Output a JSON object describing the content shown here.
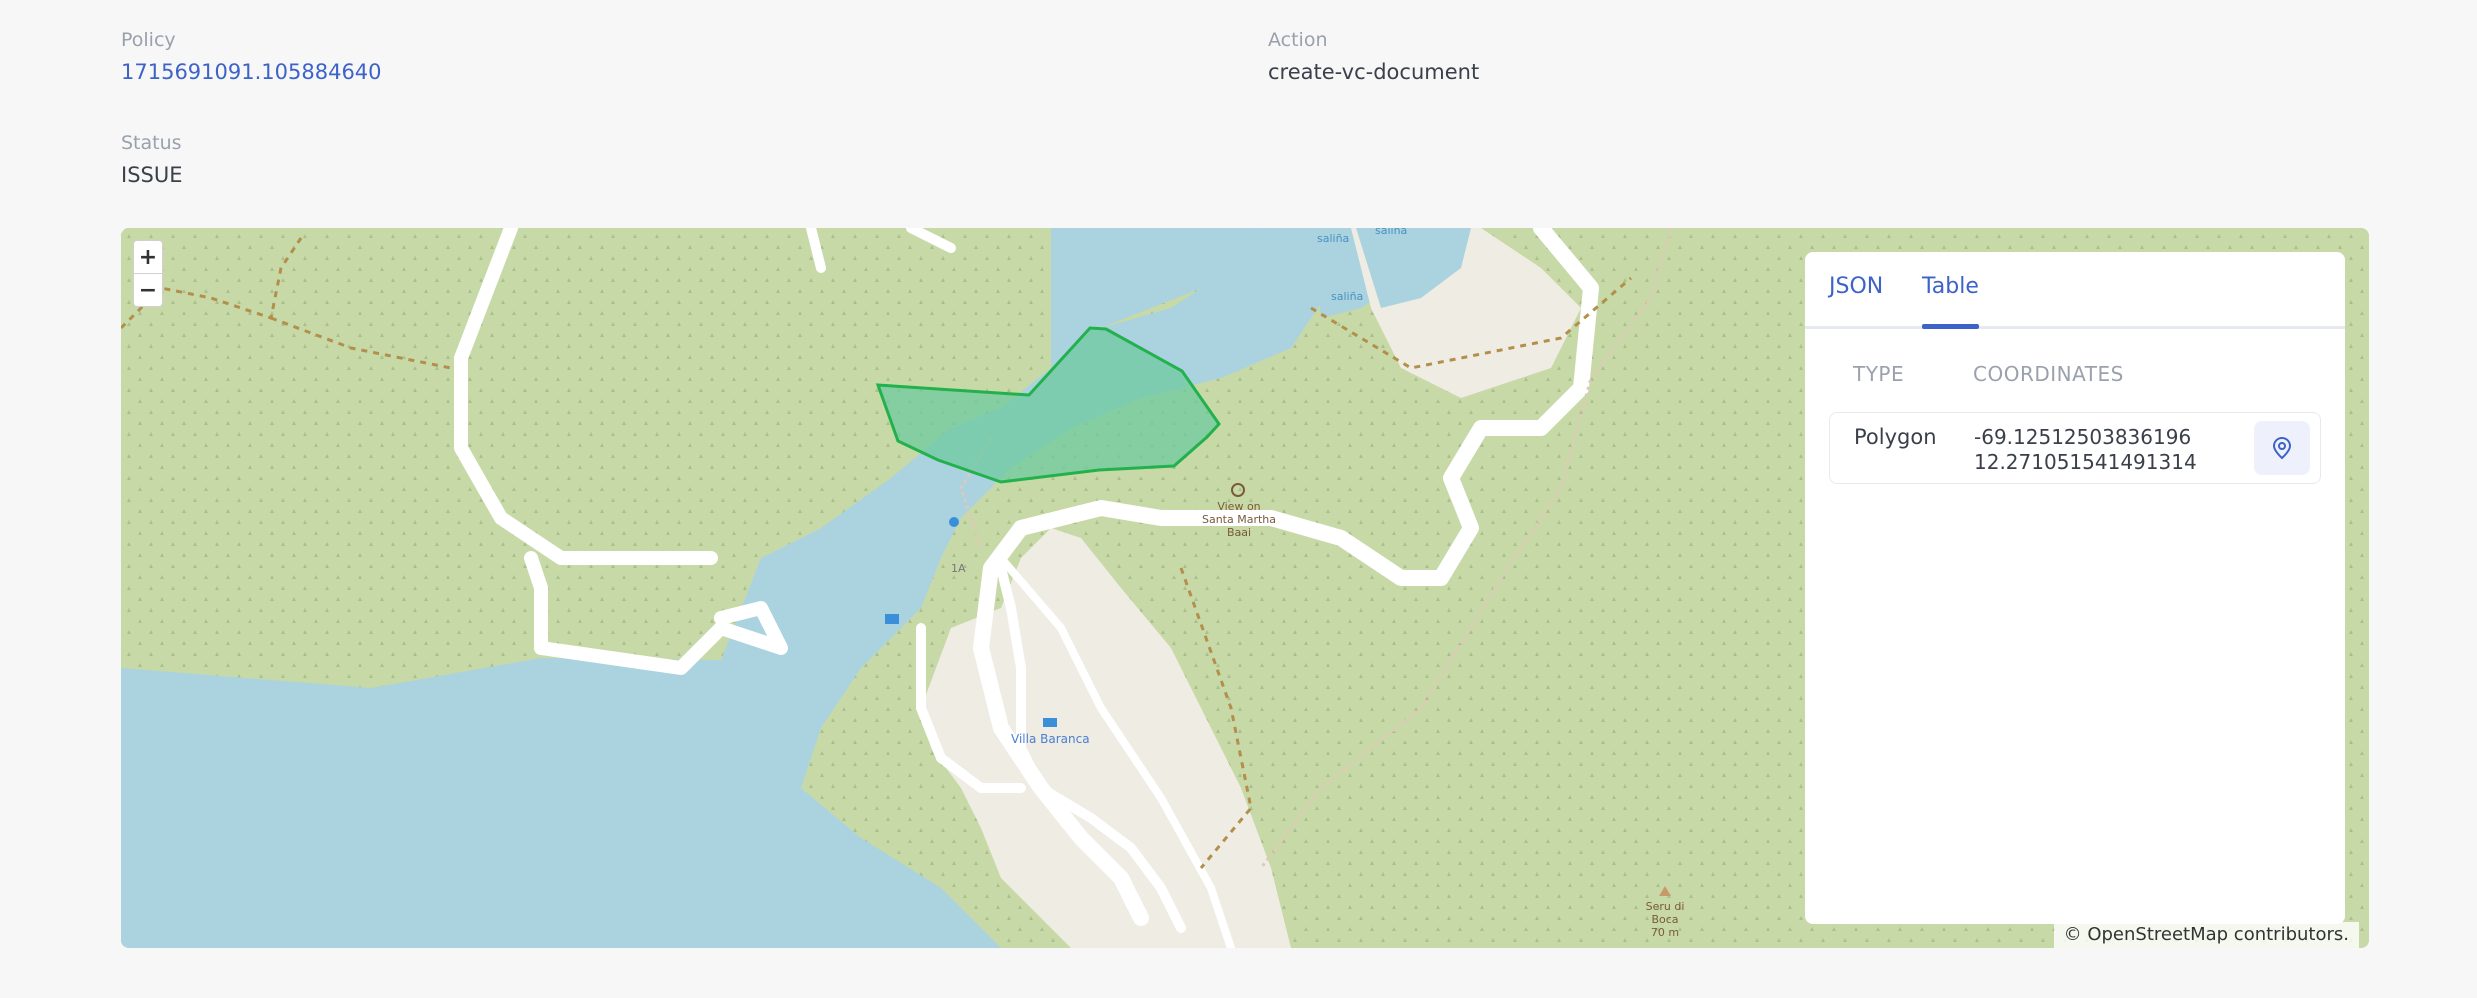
{
  "fields": {
    "policy": {
      "label": "Policy",
      "value": "1715691091.105884640"
    },
    "action": {
      "label": "Action",
      "value": "create-vc-document"
    },
    "status": {
      "label": "Status",
      "value": "ISSUE"
    }
  },
  "map": {
    "zoom_in": "+",
    "zoom_out": "−",
    "attribution": "© OpenStreetMap contributors.",
    "labels": {
      "salina1": "saliña",
      "salina2": "saliña",
      "salina3": "saliña",
      "viewpoint_1": "View on",
      "viewpoint_2": "Santa Martha",
      "viewpoint_3": "Baai",
      "road": "1A",
      "villa": "Villa Baranca",
      "peak_1": "Seru di",
      "peak_2": "Boca",
      "peak_3": "70 m"
    },
    "colors": {
      "land": "#c8d9a8",
      "water": "#aad3df",
      "polygon_fill": "#6fcaa0",
      "polygon_stroke": "#22b14c"
    }
  },
  "panel": {
    "tabs": [
      {
        "label": "JSON",
        "active": false
      },
      {
        "label": "Table",
        "active": true
      }
    ],
    "table": {
      "columns": [
        "TYPE",
        "COORDINATES"
      ],
      "rows": [
        {
          "type": "Polygon",
          "coord_x": "-69.12512503836196",
          "coord_y": "12.271051541491314"
        }
      ]
    },
    "row_action_icon": "location-pin-icon"
  }
}
